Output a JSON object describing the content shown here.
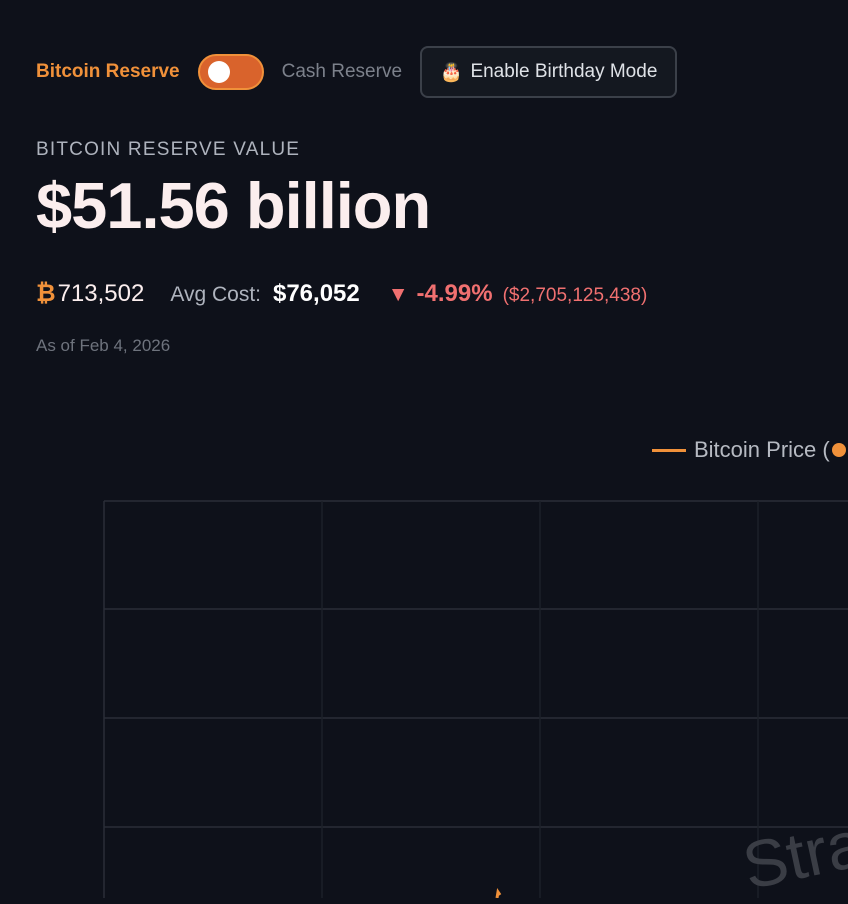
{
  "toolbar": {
    "bitcoin_label": "Bitcoin Reserve",
    "cash_label": "Cash Reserve",
    "birthday_label": "Enable Birthday Mode",
    "birthday_icon": "🎂"
  },
  "summary": {
    "kicker": "BITCOIN RESERVE VALUE",
    "value": "$51.56 billion",
    "btc_symbol": "₿",
    "holdings": "713,502",
    "avg_cost_label": "Avg Cost:",
    "avg_cost": "$76,052",
    "change_icon": "▼",
    "change_pct": "-4.99%",
    "change_abs": "($2,705,125,438)",
    "as_of": "As of Feb 4, 2026"
  },
  "chart": {
    "legend_label": "Bitcoin Price (",
    "watermark": "Stra"
  },
  "colors": {
    "accent": "#f0913a",
    "negative": "#f07070",
    "background": "#0e111a"
  }
}
